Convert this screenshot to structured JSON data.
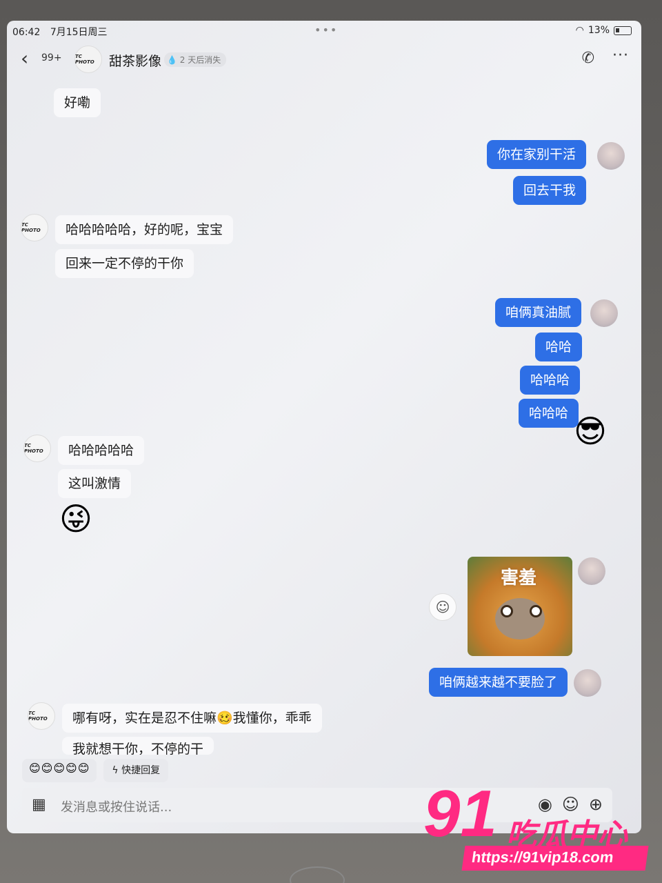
{
  "status_bar": {
    "time": "06:42",
    "date": "7月15日周三",
    "battery": "13%"
  },
  "header": {
    "back_icon": "chevron-left-icon",
    "unread_count": "99+",
    "avatar_text": "TC PHOTO",
    "title": "甜茶影像",
    "expire_note": "2 天后消失"
  },
  "messages": {
    "m1": "好嘞",
    "m2": "你在家别干活",
    "m3": "回去干我",
    "m4": "哈哈哈哈哈，好的呢，宝宝",
    "m5": "回来一定不停的干你",
    "m6": "咱俩真油腻",
    "m7": "哈哈",
    "m8": "哈哈哈",
    "m9": "哈哈哈",
    "m10": "哈哈哈哈哈",
    "m11": "这叫激情",
    "m12": "😜",
    "sticker_caption": "害羞",
    "m13": "咱俩越来越不要脸了",
    "m14": "哪有呀，实在是忍不住嘛🥴我懂你，乖乖",
    "m15": "我就想干你，不停的干"
  },
  "contact_avatar_text": "TC PHOTO",
  "quick": {
    "emojis": "😊😊😊😊😊",
    "reply_label": "快捷回复"
  },
  "input": {
    "placeholder": "发消息或按住说话..."
  },
  "watermark": {
    "number": "91",
    "text": "吃瓜中心",
    "url": "https://91vip18.com"
  },
  "colors": {
    "outgoing_bubble": "#2e6fe6",
    "incoming_bubble": "#f8f8fa",
    "watermark": "#ff2a82"
  }
}
